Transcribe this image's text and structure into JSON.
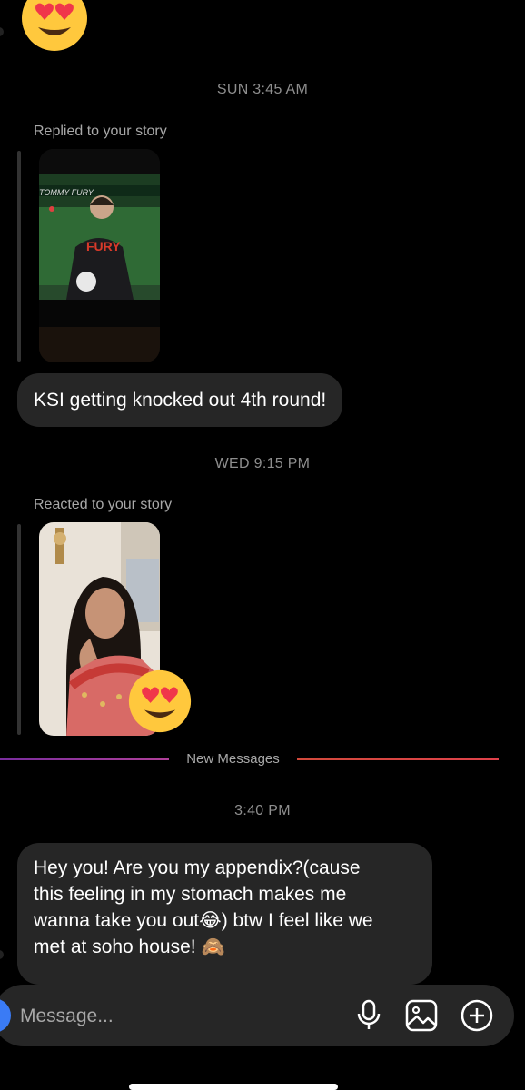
{
  "top_reaction": {
    "emoji": "heart-eyes-emoji"
  },
  "sections": {
    "ts1": "SUN 3:45 AM",
    "story1_label": "Replied to your story",
    "story1_thumb_text": "TOMMY FURY",
    "message1": "KSI getting knocked out 4th round!",
    "ts2": "WED 9:15 PM",
    "story2_label": "Reacted to your story",
    "new_messages": "New Messages",
    "ts3": "3:40 PM",
    "message2_line1": "Hey you! Are you my appendix?(cause",
    "message2_line2": "this feeling in my stomach makes me",
    "message2_line3a": "wanna take you out",
    "message2_emoji1": "😂",
    "message2_line3b": ") btw I feel like we",
    "message2_line4": "met at soho house! ",
    "message2_emoji2": "🙈"
  },
  "composer": {
    "placeholder": "Message...",
    "icons": [
      "microphone-icon",
      "image-icon",
      "plus-icon"
    ]
  },
  "colors": {
    "background": "#000000",
    "bubble": "#262626",
    "timestamp": "#8e8e8e",
    "divider_left": "#9b3fb5",
    "divider_right": "#e0424b"
  }
}
